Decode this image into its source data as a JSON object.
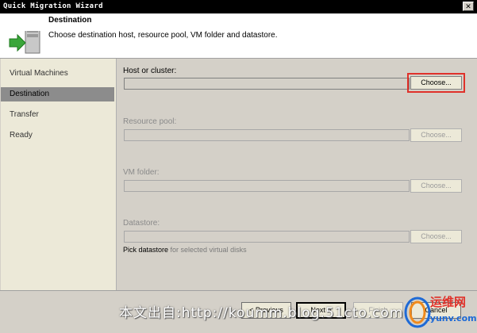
{
  "window": {
    "title": "Quick Migration Wizard",
    "close_glyph": "✕"
  },
  "header": {
    "title": "Destination",
    "subtitle": "Choose destination host, resource pool, VM folder and datastore.",
    "icon": "server-migration-icon"
  },
  "sidebar": {
    "items": [
      {
        "label": "Virtual Machines",
        "selected": false
      },
      {
        "label": "Destination",
        "selected": true
      },
      {
        "label": "Transfer",
        "selected": false
      },
      {
        "label": "Ready",
        "selected": false
      }
    ]
  },
  "form": {
    "host": {
      "label": "Host or cluster:",
      "value": "",
      "button": "Choose..."
    },
    "resource_pool": {
      "label": "Resource pool:",
      "value": "",
      "button": "Choose..."
    },
    "vm_folder": {
      "label": "VM folder:",
      "value": "",
      "button": "Choose..."
    },
    "datastore": {
      "label": "Datastore:",
      "value": "",
      "button": "Choose..."
    },
    "hint": {
      "prefix": "Pick datastore",
      "suffix": " for selected virtual disks"
    }
  },
  "footer": {
    "previous": "< Previous",
    "next": "Next >",
    "finish": "Finish",
    "cancel": "Cancel"
  },
  "watermark": {
    "text": "本文出自:http://koumm.blog.51cto.com",
    "logo_top": "运维网",
    "logo_bottom": "iyunv.com"
  },
  "colors": {
    "highlight": "#e0312a",
    "selected_row": "#8c8c8c",
    "accent_green": "#3aa63a"
  }
}
